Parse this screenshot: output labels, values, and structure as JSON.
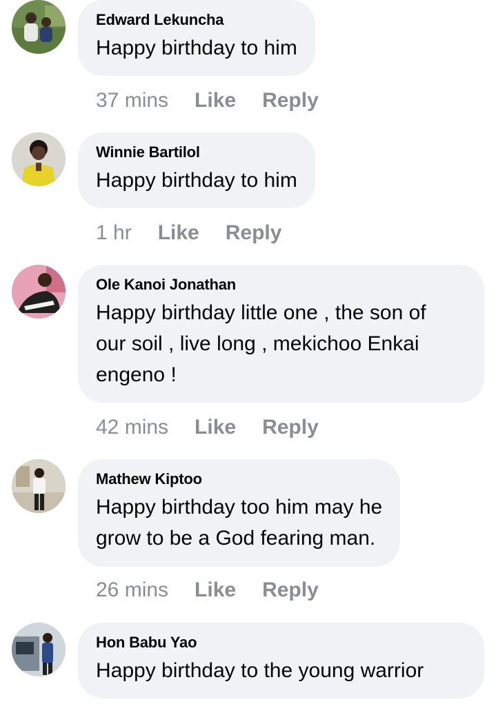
{
  "comments": [
    {
      "author": "Edward Lekuncha",
      "text": "Happy birthday to him",
      "time": "37 mins",
      "like_label": "Like",
      "reply_label": "Reply"
    },
    {
      "author": "Winnie Bartilol",
      "text": "Happy birthday to him",
      "time": "1 hr",
      "like_label": "Like",
      "reply_label": "Reply"
    },
    {
      "author": "Ole Kanoi Jonathan",
      "text": "Happy birthday little one , the son of\nour soil , live long , mekichoo Enkai\nengeno !",
      "time": "42 mins",
      "like_label": "Like",
      "reply_label": "Reply"
    },
    {
      "author": "Mathew Kiptoo",
      "text": "Happy birthday too him may he\ngrow to be a God fearing man.",
      "time": "26 mins",
      "like_label": "Like",
      "reply_label": "Reply"
    },
    {
      "author": "Hon Babu Yao",
      "text": "Happy birthday to the young warrior"
    }
  ]
}
